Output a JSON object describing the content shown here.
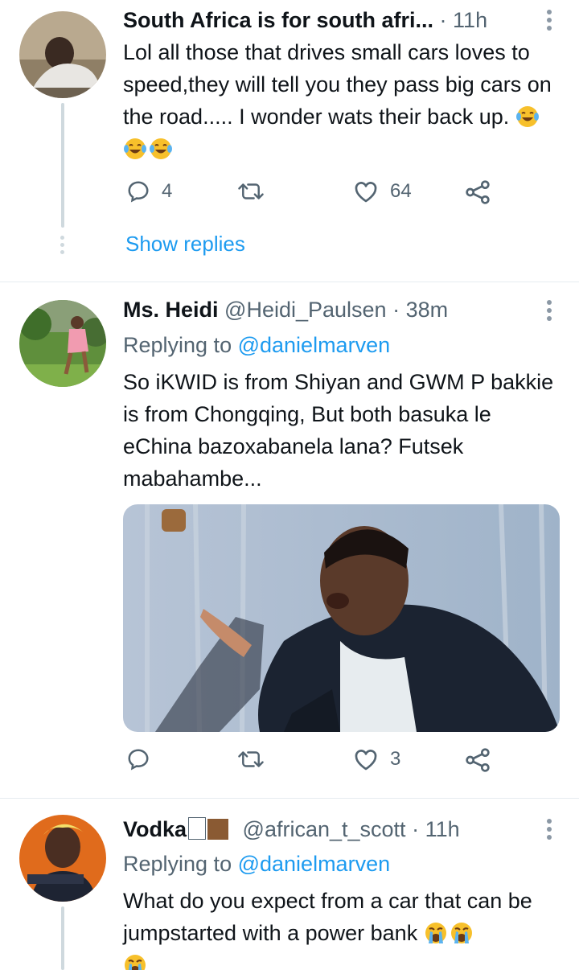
{
  "tweets": [
    {
      "author_name": "South Africa is for south afri...",
      "handle": "",
      "time": "· 11h",
      "replying_label": "",
      "replying_handle": "",
      "text": "Lol all those that drives small cars loves to speed,they will tell you they pass big cars on the road..... I wonder wats their back up.",
      "emoji": "laughing-tears-emoji",
      "emoji_count": 3,
      "reply_count": "4",
      "retweet_count": "",
      "like_count": "64",
      "show_replies_label": "Show replies"
    },
    {
      "author_name": "Ms. Heidi",
      "handle": "@Heidi_Paulsen",
      "time": "· 38m",
      "replying_label": "Replying to ",
      "replying_handle": "@danielmarven",
      "text": "So iKWID is from Shiyan and GWM P bakkie is from Chongqing, But both basuka le eChina bazoxabanela lana? Futsek mabahambe...",
      "media": "photo-man-leather-jacket-gesturing",
      "reply_count": "",
      "retweet_count": "",
      "like_count": "3"
    },
    {
      "author_name": "Vodka",
      "name_suffix": "🇿🇦🟫",
      "handle": "@african_t_scott",
      "time": "· 11h",
      "replying_label": "Replying to ",
      "replying_handle": "@danielmarven",
      "text": "What do you expect from a car that can be jumpstarted with a power bank",
      "emoji": "crying-emoji",
      "emoji_count": 3
    }
  ],
  "icons": [
    "reply-icon",
    "retweet-icon",
    "like-icon",
    "share-icon",
    "more-options-icon"
  ],
  "colors": {
    "accent": "#1d9bf0",
    "muted": "#536471",
    "text": "#0f1419",
    "divider": "#e6ecf0",
    "thread": "#cfd9de"
  }
}
